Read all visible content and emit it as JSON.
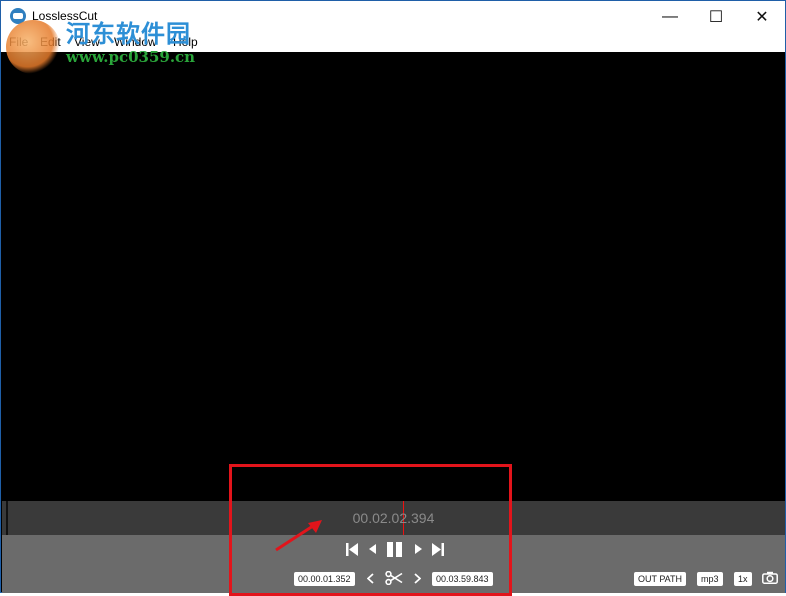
{
  "window": {
    "title": "LosslessCut",
    "minimize_label": "—",
    "maximize_label": "☐",
    "close_label": "✕"
  },
  "menu": {
    "file": "File",
    "edit": "Edit",
    "view": "View",
    "window": "Window",
    "help": "Help"
  },
  "watermark": {
    "text": "河东软件园",
    "url": "www.pc0359.cn"
  },
  "player": {
    "current_time": "00.02.02.394"
  },
  "controls": {
    "cut_start": "00.00.01.352",
    "cut_end": "00.03.59.843",
    "out_path_label": "OUT PATH",
    "format_label": "mp3",
    "speed_label": "1x"
  },
  "colors": {
    "annotation": "#e2141b",
    "playhead": "#e11111",
    "watermark_text": "#2d8fd6",
    "watermark_url": "#2aa53a"
  },
  "icons": [
    "app-icon",
    "jump-start-icon",
    "step-back-icon",
    "pause-icon",
    "step-forward-icon",
    "jump-end-icon",
    "prev-cut-icon",
    "scissors-icon",
    "next-cut-icon",
    "camera-icon"
  ]
}
